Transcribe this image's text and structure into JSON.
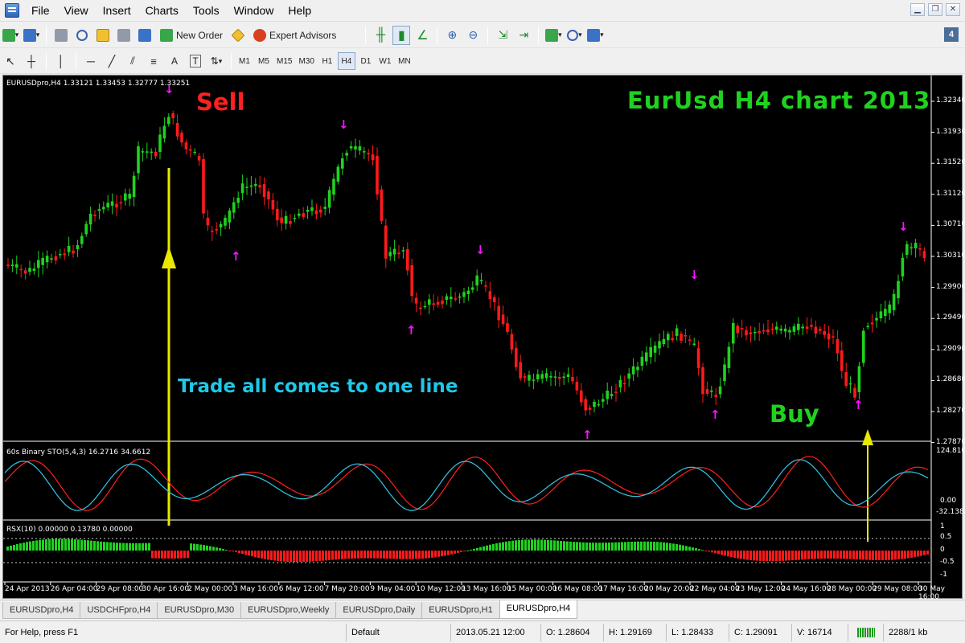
{
  "menu": [
    "File",
    "View",
    "Insert",
    "Charts",
    "Tools",
    "Window",
    "Help"
  ],
  "toolbar": {
    "new_order": "New Order",
    "expert_advisors": "Expert Advisors",
    "window_count": "4",
    "timeframes": [
      "M1",
      "M5",
      "M15",
      "M30",
      "H1",
      "H4",
      "D1",
      "W1",
      "MN"
    ],
    "active_timeframe": "H4"
  },
  "chart": {
    "symbol_info": "EURUSDpro,H4  1.33121 1.33453 1.32777 1.33251",
    "annotations": {
      "sell": "Sell",
      "title": "EurUsd  H4  chart  2013",
      "trade": "Trade all comes to one line",
      "buy": "Buy"
    },
    "price_axis": [
      "1.32340",
      "1.31930",
      "1.31520",
      "1.31120",
      "1.30710",
      "1.30310",
      "1.29900",
      "1.29490",
      "1.29090",
      "1.28680",
      "1.28270",
      "1.27870"
    ],
    "time_axis": [
      "24 Apr 2013",
      "26 Apr 04:00",
      "29 Apr 08:00",
      "30 Apr 16:00",
      "2 May 00:00",
      "3 May 16:00",
      "6 May 12:00",
      "7 May 20:00",
      "9 May 04:00",
      "10 May 12:00",
      "13 May 16:00",
      "15 May 00:00",
      "16 May 08:00",
      "17 May 16:00",
      "20 May 20:00",
      "22 May 04:00",
      "23 May 12:00",
      "24 May 16:00",
      "28 May 00:00",
      "29 May 08:00",
      "30 May 16:00"
    ],
    "colors": {
      "bull": "#1fd21f",
      "bear": "#ff1a1a",
      "arrow": "#ff10ff",
      "annotation_arrow": "#e8e800"
    }
  },
  "indicators": {
    "stochastic": {
      "label": "60s Binary STO(5,4,3) 16.2716 34.6612",
      "max": "124.8104",
      "zero": "0.00",
      "min": "-32.1388"
    },
    "rsx": {
      "label": "RSX(10) 0.00000 0.13780 0.00000",
      "levels": [
        "1",
        "0.5",
        "0",
        "-0.5",
        "-1"
      ]
    }
  },
  "tabs": [
    "EURUSDpro,H4",
    "USDCHFpro,H4",
    "EURUSDpro,M30",
    "EURUSDpro,Weekly",
    "EURUSDpro,Daily",
    "EURUSDpro,H1",
    "EURUSDpro,H4"
  ],
  "active_tab": 6,
  "status": {
    "help": "For Help, press F1",
    "profile": "Default",
    "datetime": "2013.05.21 12:00",
    "open": "O: 1.28604",
    "high": "H: 1.29169",
    "low": "L: 1.28433",
    "close": "C: 1.29091",
    "volume": "V: 16714",
    "traffic": "2288/1 kb"
  }
}
